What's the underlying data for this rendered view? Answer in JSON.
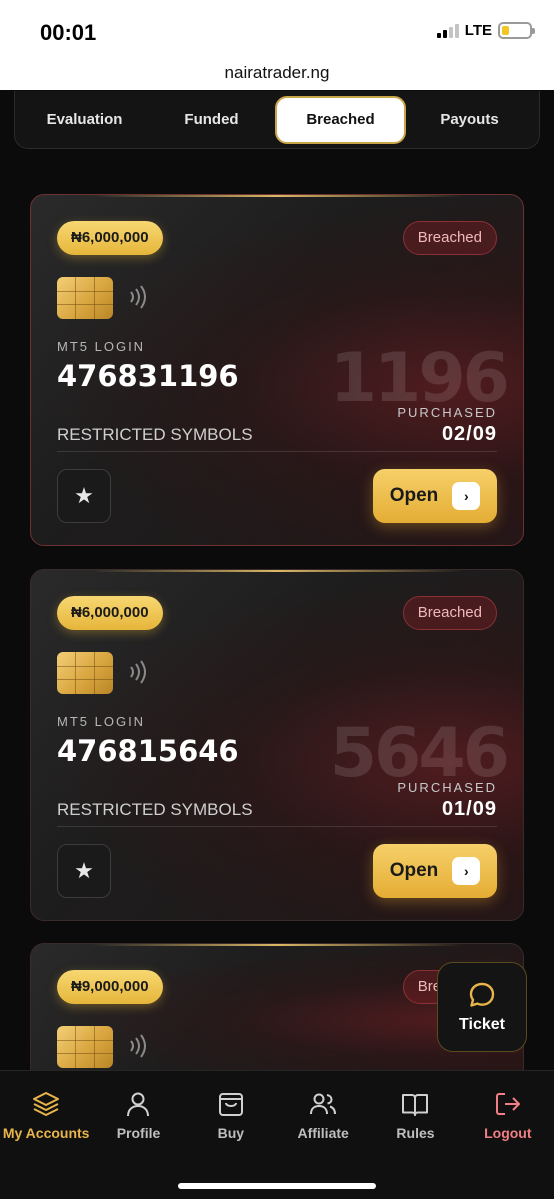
{
  "status_bar": {
    "time": "00:01",
    "network": "LTE"
  },
  "address_bar": {
    "url": "nairatrader.ng"
  },
  "tabs": [
    {
      "label": "Evaluation",
      "active": false
    },
    {
      "label": "Funded",
      "active": false
    },
    {
      "label": "Breached",
      "active": true
    },
    {
      "label": "Payouts",
      "active": false
    }
  ],
  "cards": [
    {
      "amount": "₦6,000,000",
      "status": "Breached",
      "mt5_label": "MT5 LOGIN",
      "login": "476831196",
      "short_id": "1196",
      "purchased_label": "PURCHASED",
      "purchased_date": "02/09",
      "restricted_label": "RESTRICTED SYMBOLS",
      "open_label": "Open"
    },
    {
      "amount": "₦6,000,000",
      "status": "Breached",
      "mt5_label": "MT5 LOGIN",
      "login": "476815646",
      "short_id": "5646",
      "purchased_label": "PURCHASED",
      "purchased_date": "01/09",
      "restricted_label": "RESTRICTED SYMBOLS",
      "open_label": "Open"
    },
    {
      "amount": "₦9,000,000",
      "status": "Breached"
    }
  ],
  "ticket": {
    "label": "Ticket"
  },
  "bottom_nav": [
    {
      "label": "My Accounts",
      "icon": "layers-icon",
      "active": true
    },
    {
      "label": "Profile",
      "icon": "user-icon"
    },
    {
      "label": "Buy",
      "icon": "shopping-bag-icon"
    },
    {
      "label": "Affiliate",
      "icon": "users-icon"
    },
    {
      "label": "Rules",
      "icon": "book-icon"
    },
    {
      "label": "Logout",
      "icon": "logout-icon"
    }
  ],
  "colors": {
    "accent_gold": "#e8b54b",
    "breached_red": "#8a3036",
    "logout_red": "#f07f86"
  }
}
